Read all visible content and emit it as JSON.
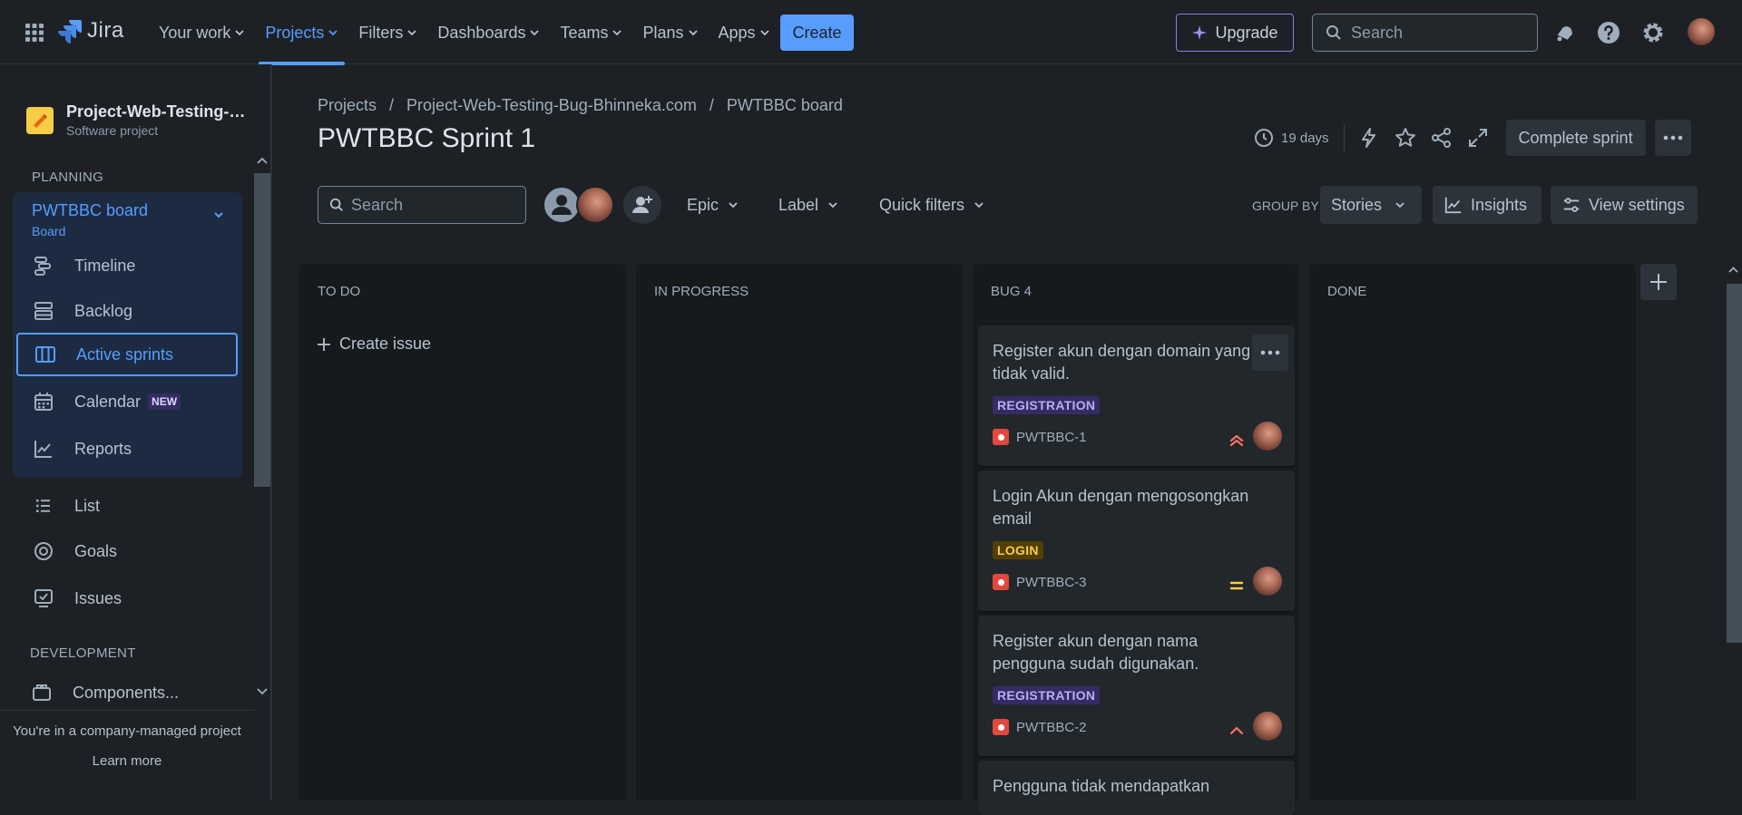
{
  "app": {
    "name": "Jira"
  },
  "nav": {
    "items": [
      {
        "label": "Your work"
      },
      {
        "label": "Projects"
      },
      {
        "label": "Filters"
      },
      {
        "label": "Dashboards"
      },
      {
        "label": "Teams"
      },
      {
        "label": "Plans"
      },
      {
        "label": "Apps"
      }
    ],
    "active": "Projects",
    "create_label": "Create",
    "upgrade_label": "Upgrade",
    "search_placeholder": "Search"
  },
  "sidebar": {
    "project_name": "Project-Web-Testing-Bug-Bhinneka.com",
    "project_type": "Software project",
    "planning_label": "PLANNING",
    "board_title": "PWTBBC board",
    "board_sub": "Board",
    "planning_items": [
      {
        "label": "Timeline",
        "icon": "timeline-icon"
      },
      {
        "label": "Backlog",
        "icon": "backlog-icon"
      },
      {
        "label": "Active sprints",
        "icon": "board-columns-icon"
      },
      {
        "label": "Calendar",
        "icon": "calendar-icon",
        "badge": "NEW"
      },
      {
        "label": "Reports",
        "icon": "reports-icon"
      }
    ],
    "other_items": [
      {
        "label": "List",
        "icon": "list-icon"
      },
      {
        "label": "Goals",
        "icon": "goals-icon"
      },
      {
        "label": "Issues",
        "icon": "issues-icon"
      }
    ],
    "development_label": "DEVELOPMENT",
    "dev_items": [
      {
        "label": "Components...",
        "icon": "components-icon"
      }
    ],
    "footer_text": "You're in a company-managed project",
    "footer_link": "Learn more"
  },
  "main": {
    "breadcrumb": [
      "Projects",
      "Project-Web-Testing-Bug-Bhinneka.com",
      "PWTBBC board"
    ],
    "title": "PWTBBC Sprint 1",
    "days_remaining": "19 days",
    "complete_sprint_label": "Complete sprint",
    "search_placeholder": "Search",
    "filters": {
      "epic": "Epic",
      "label": "Label",
      "quick": "Quick filters"
    },
    "group_by_label": "GROUP BY",
    "group_by_value": "Stories",
    "insights_label": "Insights",
    "view_settings_label": "View settings"
  },
  "board": {
    "columns": [
      {
        "title": "TO DO"
      },
      {
        "title": "IN PROGRESS"
      },
      {
        "title": "BUG 4"
      },
      {
        "title": "DONE"
      }
    ],
    "create_issue_label": "Create issue",
    "cards": [
      {
        "title": "Register akun dengan domain yang tidak valid.",
        "label": "REGISTRATION",
        "label_color": "purple",
        "key": "PWTBBC-1",
        "priority": "highest"
      },
      {
        "title": "Login Akun dengan mengosongkan email",
        "label": "LOGIN",
        "label_color": "yellow",
        "key": "PWTBBC-3",
        "priority": "medium"
      },
      {
        "title": "Register akun dengan nama pengguna sudah digunakan.",
        "label": "REGISTRATION",
        "label_color": "purple",
        "key": "PWTBBC-2",
        "priority": "high"
      },
      {
        "title": "Pengguna tidak mendapatkan",
        "label": "",
        "label_color": "",
        "key": "",
        "priority": ""
      }
    ]
  },
  "colors": {
    "accent": "#579dff",
    "background": "#1d2125",
    "column": "#161a1d",
    "card": "#22272b",
    "priority_high": "#f87462",
    "priority_medium": "#f5cd47"
  }
}
